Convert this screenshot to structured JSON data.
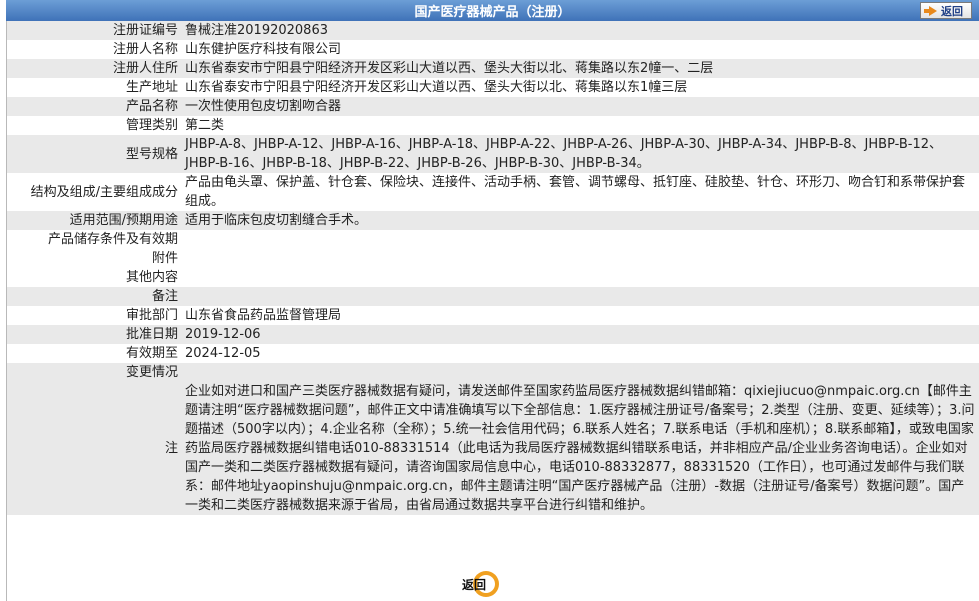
{
  "header": {
    "title": "国产医疗器械产品（注册）",
    "back_label": "返回"
  },
  "rows": [
    {
      "label": "注册证编号",
      "value": "鲁械注准20192020863",
      "shade": "grey"
    },
    {
      "label": "注册人名称",
      "value": "山东健护医疗科技有限公司",
      "shade": "white"
    },
    {
      "label": "注册人住所",
      "value": "山东省泰安市宁阳县宁阳经济开发区彩山大道以西、堡头大街以北、蒋集路以东2幢一、二层",
      "shade": "grey"
    },
    {
      "label": "生产地址",
      "value": "山东省泰安市宁阳县宁阳经济开发区彩山大道以西、堡头大街以北、蒋集路以东1幢三层",
      "shade": "white"
    },
    {
      "label": "产品名称",
      "value": "一次性使用包皮切割吻合器",
      "shade": "grey"
    },
    {
      "label": "管理类别",
      "value": "第二类",
      "shade": "white"
    },
    {
      "label": "型号规格",
      "value": "JHBP-A-8、JHBP-A-12、JHBP-A-16、JHBP-A-18、JHBP-A-22、JHBP-A-26、JHBP-A-30、JHBP-A-34、JHBP-B-8、JHBP-B-12、JHBP-B-16、JHBP-B-18、JHBP-B-22、JHBP-B-26、JHBP-B-30、JHBP-B-34。",
      "shade": "grey"
    },
    {
      "label": "结构及组成/主要组成成分",
      "value": "产品由龟头罩、保护盖、针仓套、保险块、连接件、活动手柄、套管、调节螺母、抵钉座、硅胶垫、针仓、环形刀、吻合钉和系带保护套组成。",
      "shade": "white"
    },
    {
      "label": "适用范围/预期用途",
      "value": "适用于临床包皮切割缝合手术。",
      "shade": "grey"
    },
    {
      "label": "产品储存条件及有效期",
      "value": "",
      "shade": "white"
    },
    {
      "label": "附件",
      "value": "",
      "shade": "white"
    },
    {
      "label": "其他内容",
      "value": "",
      "shade": "white"
    },
    {
      "label": "备注",
      "value": "",
      "shade": "grey"
    },
    {
      "label": "审批部门",
      "value": "山东省食品药品监督管理局",
      "shade": "white"
    },
    {
      "label": "批准日期",
      "value": "2019-12-06",
      "shade": "grey"
    },
    {
      "label": "有效期至",
      "value": "2024-12-05",
      "shade": "white"
    },
    {
      "label": "变更情况",
      "value": "",
      "shade": "grey"
    }
  ],
  "note": {
    "label": "注",
    "text": "企业如对进口和国产三类医疗器械数据有疑问，请发送邮件至国家药监局医疗器械数据纠错邮箱：qixiejiucuo@nmpaic.org.cn【邮件主题请注明“医疗器械数据问题”，邮件正文中请准确填写以下全部信息：1.医疗器械注册证号/备案号；2.类型（注册、变更、延续等）；3.问题描述（500字以内）；4.企业名称（全称）；5.统一社会信用代码；6.联系人姓名；7.联系电话（手机和座机）；8.联系邮箱】，或致电国家药监局医疗器械数据纠错电话010-88331514（此电话为我局医疗器械数据纠错联系电话，并非相应产品/企业业务咨询电话）。企业如对国产一类和二类医疗器械数据有疑问，请咨询国家局信息中心，电话010-88332877，88331520（工作日），也可通过发邮件与我们联系：邮件地址yaopinshuju@nmpaic.org.cn，邮件主题请注明“国产医疗器械产品（注册）-数据（注册证号/备案号）数据问题”。国产一类和二类医疗器械数据来源于省局，由省局通过数据共享平台进行纠错和维护。"
  },
  "footer": {
    "back_label": "返回"
  },
  "colors": {
    "header_top": "#6c9ed6",
    "header_bottom": "#3f72b8",
    "row_grey": "#e9e9e9",
    "back_ring": "#f0a020"
  }
}
